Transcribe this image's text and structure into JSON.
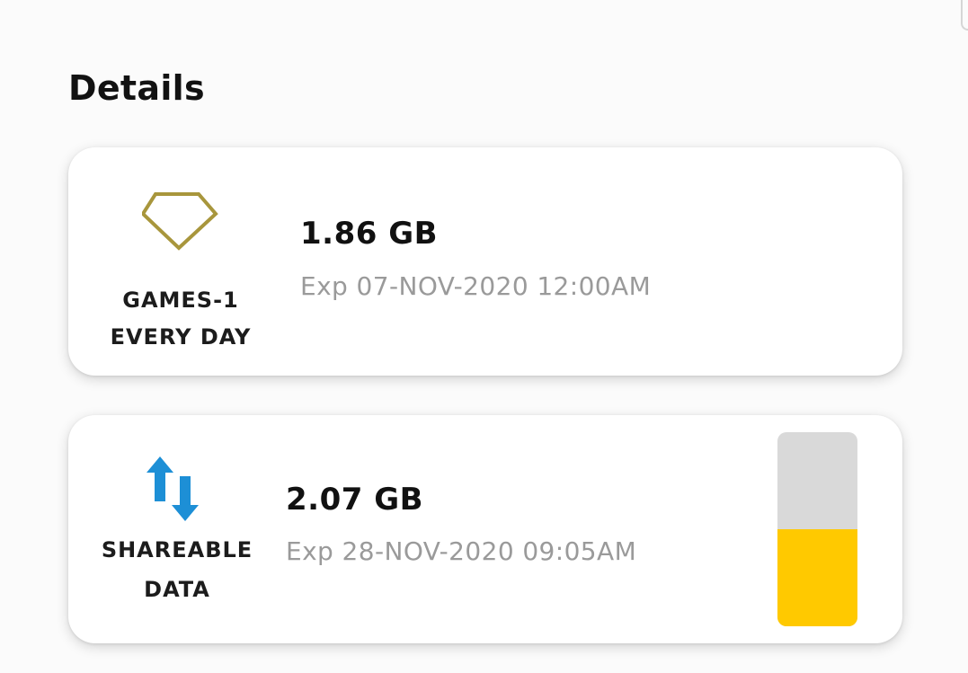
{
  "details": {
    "title": "Details"
  },
  "cards": [
    {
      "icon": "diamond-icon",
      "icon_color": "#a8963c",
      "pack_name": "GAMES-1\nEVERY DAY",
      "amount": "1.86 GB",
      "expiry": "Exp 07-NOV-2020 12:00AM"
    },
    {
      "icon": "transfer-arrows-icon",
      "icon_color": "#1d8fd6",
      "pack_name": "SHAREABLE\nDATA",
      "amount": "2.07 GB",
      "expiry": "Exp 28-NOV-2020 09:05AM",
      "remaining_fraction": 0.5,
      "bar_fill_color": "#ffc900",
      "bar_track_color": "#d9d9d9"
    }
  ]
}
